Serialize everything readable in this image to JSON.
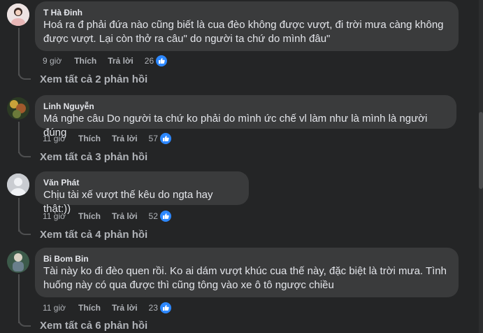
{
  "comments": [
    {
      "author": "T Hà Đinh",
      "text_lines": [
        "Hoá ra đ phải đứa nào cũng biết là cua đèo không được vượt, đi trời mưa càng không",
        "được vượt. Lại còn thở ra câu\" do người ta chứ do mình đâu\""
      ],
      "time": "9 giờ",
      "like_label": "Thích",
      "reply_label": "Trả lời",
      "reaction_count": "26",
      "reaction_icon": "thumbs-up-icon",
      "view_replies": "Xem tất cả 2 phản hồi"
    },
    {
      "author": "Linh Nguyễn",
      "text_lines": [
        "Má nghe câu Do người ta chứ ko phải do mình ức chế vl làm như là mình là người đúng"
      ],
      "time": "11 giờ",
      "like_label": "Thích",
      "reply_label": "Trả lời",
      "reaction_count": "57",
      "reaction_icon": "thumbs-up-icon",
      "view_replies": "Xem tất cả 3 phản hồi"
    },
    {
      "author": "Văn Phát",
      "text_lines": [
        "Chịu tài xế vượt thế kêu do ngta hay thật:))"
      ],
      "time": "11 giờ",
      "like_label": "Thích",
      "reply_label": "Trả lời",
      "reaction_count": "52",
      "reaction_icon": "thumbs-up-icon",
      "view_replies": "Xem tất cả 4 phản hồi"
    },
    {
      "author": "Bi Bom Bin",
      "text_lines": [
        "Tài này ko đi đèo quen rồi. Ko ai dám vượt khúc cua thế này, đặc biệt là trời mưa. Tình",
        "huống này có qua được thì cũng tông vào xe ô tô ngược chiều"
      ],
      "time": "11 giờ",
      "like_label": "Thích",
      "reply_label": "Trả lời",
      "reaction_count": "23",
      "reaction_icon": "thumbs-up-icon",
      "view_replies": "Xem tất cả 6 phản hồi"
    }
  ],
  "colors": {
    "background": "#242526",
    "bubble": "#3a3b3c",
    "primary_text": "#e4e6eb",
    "secondary_text": "#b0b3b8",
    "like_blue": "#2d88ff"
  }
}
